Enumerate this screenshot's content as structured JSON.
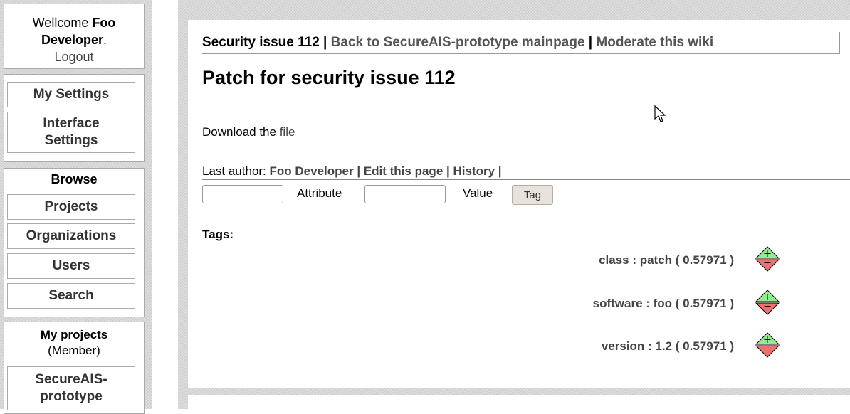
{
  "sidebar": {
    "welcome": {
      "prefix": "Wellcome ",
      "user": "Foo Developer",
      "suffix": ".",
      "logout": "Logout"
    },
    "settings": [
      "My Settings",
      "Interface Settings"
    ],
    "browse": {
      "heading": "Browse",
      "items": [
        "Projects",
        "Organizations",
        "Users",
        "Search"
      ]
    },
    "my_projects": {
      "heading": "My projects",
      "role": "(Member)",
      "items": [
        "SecureAIS-prototype"
      ]
    }
  },
  "breadcrumb": {
    "current": "Security issue 112",
    "sep1": " | ",
    "back": "Back to SecureAIS-prototype mainpage",
    "sep2": " | ",
    "moderate": "Moderate this wiki"
  },
  "page": {
    "title": "Patch for security issue 112",
    "download_prefix": "Download the ",
    "download_link": "file"
  },
  "author_line": {
    "label": "Last author: ",
    "author": "Foo Developer",
    "sep": " | ",
    "edit": "Edit this page",
    "history": "History",
    "tail": " |"
  },
  "tag_form": {
    "attribute_value": "",
    "attribute_label": "Attribute",
    "value_value": "",
    "value_label": "Value",
    "button": "Tag"
  },
  "tags": {
    "heading": "Tags:",
    "items": [
      {
        "text": "class : patch ( 0.57971 )"
      },
      {
        "text": "software : foo ( 0.57971 )"
      },
      {
        "text": "version : 1.2 ( 0.57971 )"
      }
    ]
  },
  "colors": {
    "vote_up": "#90ee90",
    "vote_down": "#f07070"
  }
}
